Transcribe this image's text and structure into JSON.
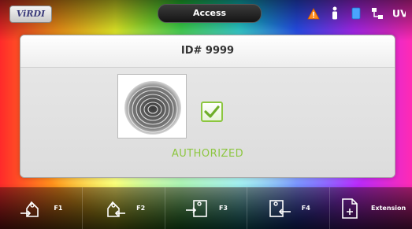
{
  "topbar": {
    "logo_text": "ViRDI",
    "title": "Access",
    "status_icons": [
      "warning-icon",
      "user-icon",
      "card-icon",
      "network-icon",
      "uv-icon"
    ],
    "uv_text": "UV"
  },
  "panel": {
    "id_label": "ID# 9999",
    "status_text": "AUTHORIZED"
  },
  "function_keys": [
    {
      "label": "F1",
      "icon": "enter-door-icon"
    },
    {
      "label": "F2",
      "icon": "exit-door-icon"
    },
    {
      "label": "F3",
      "icon": "enter-arrow-icon"
    },
    {
      "label": "F4",
      "icon": "exit-arrow-icon"
    },
    {
      "label": "Extension",
      "icon": "extension-document-icon"
    }
  ],
  "colors": {
    "accent_green": "#8cc63f",
    "warning_orange": "#ff8a1c"
  }
}
